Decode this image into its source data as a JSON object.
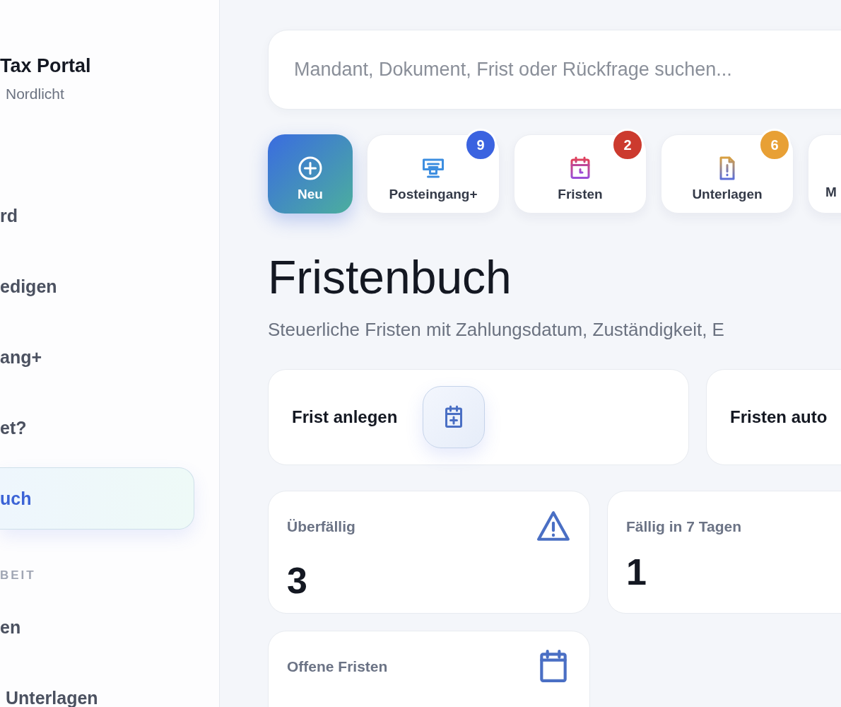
{
  "sidebar": {
    "brand": {
      "title": "Tax Portal",
      "subtitle": "Nordlicht"
    },
    "nav": [
      {
        "label": "rd",
        "selected": false
      },
      {
        "label": "edigen",
        "selected": false
      },
      {
        "label": "ang+",
        "selected": false
      },
      {
        "label": "et?",
        "selected": false
      },
      {
        "label": "uch",
        "selected": true
      }
    ],
    "section_label": "BEIT",
    "nav_2": [
      {
        "label": "en",
        "selected": false
      },
      {
        "label": "Unterlagen",
        "selected": false
      }
    ]
  },
  "search": {
    "placeholder": "Mandant, Dokument, Frist oder Rückfrage suchen..."
  },
  "shortcuts": [
    {
      "kind": "primary",
      "label": "Neu"
    },
    {
      "kind": "normal",
      "label": "Posteingang+",
      "badge": "9",
      "color": "#3b63e0"
    },
    {
      "kind": "normal",
      "label": "Fristen",
      "badge": "2",
      "color": "#cc3a2e"
    },
    {
      "kind": "normal",
      "label": "Unterlagen",
      "badge": "6",
      "color": "#e8a035"
    },
    {
      "kind": "normal",
      "label": "M"
    }
  ],
  "page": {
    "title": "Fristenbuch",
    "subtitle": "Steuerliche Fristen mit Zahlungsdatum, Zuständigkeit, E"
  },
  "actions": [
    {
      "label": "Frist anlegen"
    },
    {
      "label": "Fristen auto"
    }
  ],
  "stats": [
    {
      "label": "Überfällig",
      "value": "3"
    },
    {
      "label": "Fällig in 7 Tagen",
      "value": "1"
    },
    {
      "label": "Offene Fristen"
    }
  ]
}
